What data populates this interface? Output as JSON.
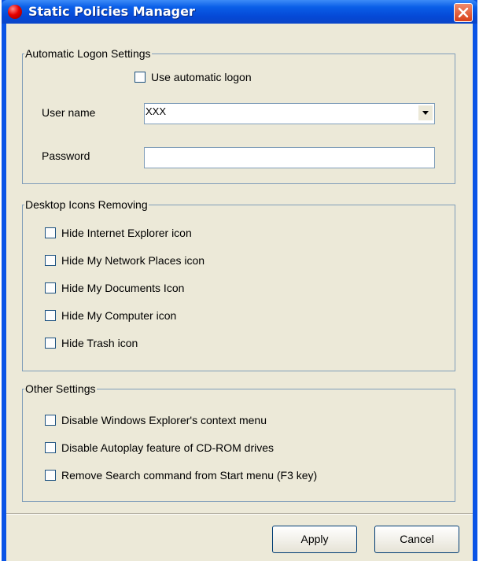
{
  "window": {
    "title": "Static Policies Manager",
    "icon": "red-orb-icon",
    "close_icon": "close-icon"
  },
  "groups": {
    "logon": {
      "label": "Automatic Logon Settings",
      "use_auto_logon": {
        "label": "Use automatic logon",
        "checked": false
      },
      "user_name": {
        "label": "User name",
        "value": "XXX"
      },
      "password": {
        "label": "Password",
        "value": ""
      }
    },
    "desktop_icons": {
      "label": "Desktop Icons Removing",
      "items": [
        {
          "label": "Hide Internet Explorer icon",
          "checked": false
        },
        {
          "label": "Hide My Network Places icon",
          "checked": false
        },
        {
          "label": "Hide My Documents Icon",
          "checked": false
        },
        {
          "label": "Hide My Computer icon",
          "checked": false
        },
        {
          "label": "Hide Trash icon",
          "checked": false
        }
      ]
    },
    "other": {
      "label": "Other Settings",
      "items": [
        {
          "label": "Disable Windows Explorer's context menu",
          "checked": false
        },
        {
          "label": "Disable Autoplay feature of CD-ROM drives",
          "checked": false
        },
        {
          "label": "Remove Search command from Start menu (F3 key)",
          "checked": false
        }
      ]
    }
  },
  "buttons": {
    "apply": "Apply",
    "cancel": "Cancel"
  },
  "colors": {
    "titlebar": "#0a54e6",
    "client_bg": "#ece9d8",
    "group_border": "#7f9db9",
    "close_button": "#e04a1e"
  }
}
